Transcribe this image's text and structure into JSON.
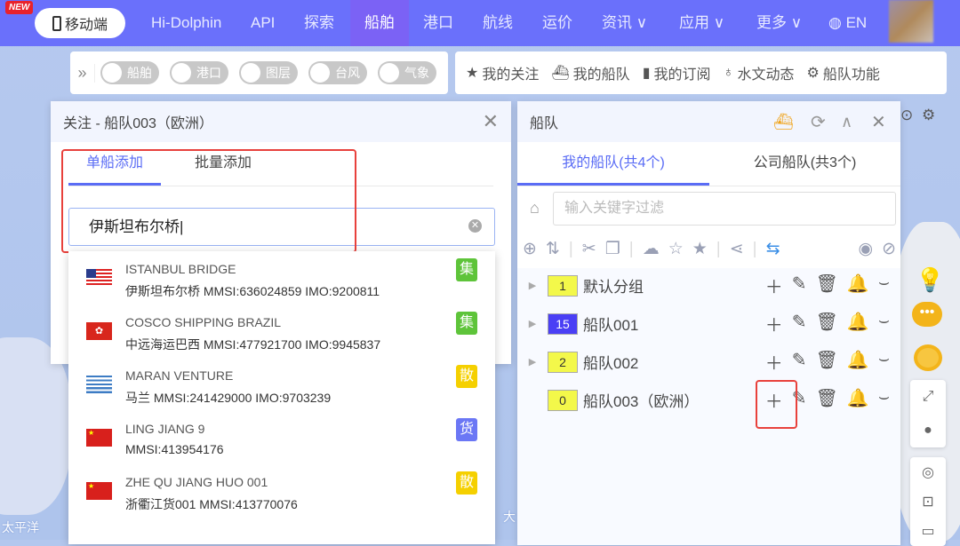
{
  "nav": {
    "new_badge": "NEW",
    "mobile": "移动端",
    "items": [
      "Hi-Dolphin",
      "API",
      "探索",
      "船舶",
      "港口",
      "航线",
      "运价",
      "资讯 ∨",
      "应用 ∨",
      "更多 ∨"
    ],
    "lang": "EN"
  },
  "toolbar": {
    "toggles": [
      "船舶",
      "港口",
      "图层",
      "台风",
      "气象"
    ],
    "links": [
      "我的关注",
      "我的船队",
      "我的订阅",
      "水文动态",
      "船队功能"
    ]
  },
  "follow_panel": {
    "title": "关注 - 船队003（欧洲）",
    "tabs": [
      "单船添加",
      "批量添加"
    ],
    "search_value": "伊斯坦布尔桥"
  },
  "results": [
    {
      "name": "ISTANBUL BRIDGE",
      "info": "伊斯坦布尔桥   MMSI:636024859  IMO:9200811",
      "badge": "集",
      "color": "#5ec43a"
    },
    {
      "name": "COSCO SHIPPING BRAZIL",
      "info": "中远海运巴西   MMSI:477921700  IMO:9945837",
      "badge": "集",
      "color": "#5ec43a"
    },
    {
      "name": "MARAN VENTURE",
      "info": "马兰   MMSI:241429000  IMO:9703239",
      "badge": "散",
      "color": "#f5d000"
    },
    {
      "name": "LING JIANG 9",
      "info": "MMSI:413954176",
      "badge": "货",
      "color": "#6b77f5"
    },
    {
      "name": "ZHE QU JIANG HUO 001",
      "info": "浙衢江货001   MMSI:413770076",
      "badge": "散",
      "color": "#f5d000"
    }
  ],
  "fleet_panel": {
    "title": "船队",
    "tabs": [
      "我的船队(共4个)",
      "公司船队(共3个)"
    ],
    "filter_placeholder": "输入关键字过滤",
    "groups": [
      {
        "count": "1",
        "name": "默认分组",
        "color": "#f3f84a"
      },
      {
        "count": "15",
        "name": "船队001",
        "color": "#4a3ff5"
      },
      {
        "count": "2",
        "name": "船队002",
        "color": "#f3f84a"
      },
      {
        "count": "0",
        "name": "船队003（欧洲）",
        "color": "#f3f84a"
      }
    ]
  },
  "map": {
    "labels": [
      "太平洋",
      "大"
    ]
  }
}
